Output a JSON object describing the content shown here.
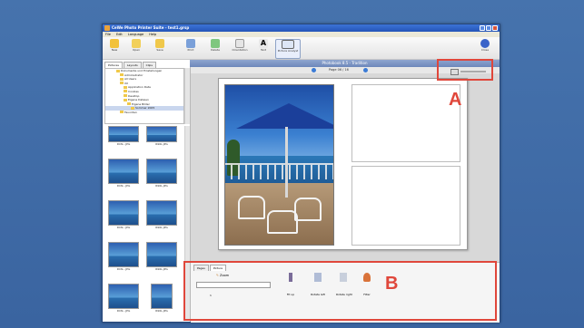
{
  "window": {
    "title": "CeWe Photo Printer Suite - test1.grsp"
  },
  "menu": [
    "File",
    "Edit",
    "Language",
    "Help"
  ],
  "toolbar": [
    {
      "label": "New",
      "icon": "new-icon",
      "color": "#f2c23b"
    },
    {
      "label": "Open",
      "icon": "open-icon",
      "color": "#f2d05a"
    },
    {
      "label": "Save",
      "icon": "save-icon",
      "color": "#f0c84a"
    },
    {
      "label": "Print",
      "icon": "print-icon",
      "color": "#7aa0d9"
    },
    {
      "label": "Delete",
      "icon": "delete-icon",
      "color": "#7fc77f"
    },
    {
      "label": "Orientation",
      "icon": "orientation-icon",
      "color": "#e5e5e5"
    },
    {
      "label": "Text",
      "icon": "text-icon",
      "color": "#e8e8e8"
    },
    {
      "label": "Picture Analyst",
      "icon": "picture-analyst-icon",
      "color": "#dde6f5"
    },
    {
      "label": "Close",
      "icon": "close-icon",
      "color": "#3a63c9"
    }
  ],
  "pathbar": "Photobook 8.5 - Tradition",
  "left_tabs": [
    "Pictures",
    "Layouts",
    "Clips"
  ],
  "tree": [
    "Dokumente und Einstellungen",
    "Administrator",
    "All Users",
    "XX",
    "Application Data",
    "Cookies",
    "Desktop",
    "Eigene Dateien",
    "Eigene Bilder",
    "Sommer 2005",
    "Favoriten"
  ],
  "thumbnails": [
    "DCN...JPG",
    "R96L.JPG",
    "DCN...JPG",
    "R96L.JPG",
    "DCN...JPG",
    "R96L.JPG",
    "DCN...JPG",
    "R96L.JPG",
    "DCN...JPG",
    "R96L.JPG"
  ],
  "page_indicator": "Page 06 / 16",
  "bottom_tabs": [
    "Pages",
    "Picture"
  ],
  "zoom_label": "Zoom",
  "zoom_value": "1",
  "tools": [
    {
      "label": "Fit up",
      "icon": "fit-icon"
    },
    {
      "label": "Rotate left",
      "icon": "rotate-left-icon"
    },
    {
      "label": "Rotate right",
      "icon": "rotate-right-icon"
    },
    {
      "label": "Filter",
      "icon": "filter-icon"
    }
  ],
  "callouts": {
    "a": "A",
    "b": "B"
  },
  "colors": {
    "accent": "#e0473b",
    "titlebar": "#2455b8",
    "desktop": "#3f6aa6"
  }
}
